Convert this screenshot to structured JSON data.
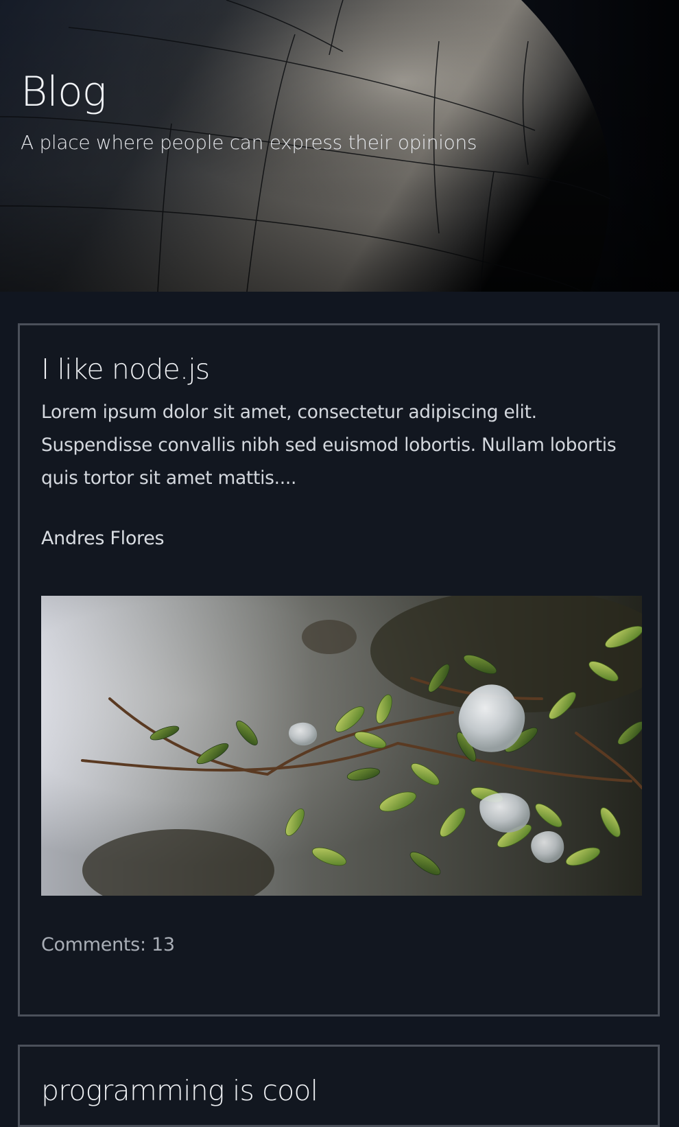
{
  "header": {
    "title": "Blog",
    "subtitle": "A place where people can express their opinions"
  },
  "posts": [
    {
      "title": "I like node.js",
      "excerpt": "Lorem ipsum dolor sit amet, consectetur adipiscing elit. Suspendisse convallis nibh sed euismod lobortis. Nullam lobortis quis tortor sit amet mattis....",
      "author": "Andres Flores",
      "comments": "Comments: 13"
    },
    {
      "title": "programming is cool"
    }
  ],
  "colors": {
    "background": "#111620",
    "card_border": "#4b505a",
    "text": "#d7dbe0",
    "muted_text": "#a9aeb6"
  }
}
